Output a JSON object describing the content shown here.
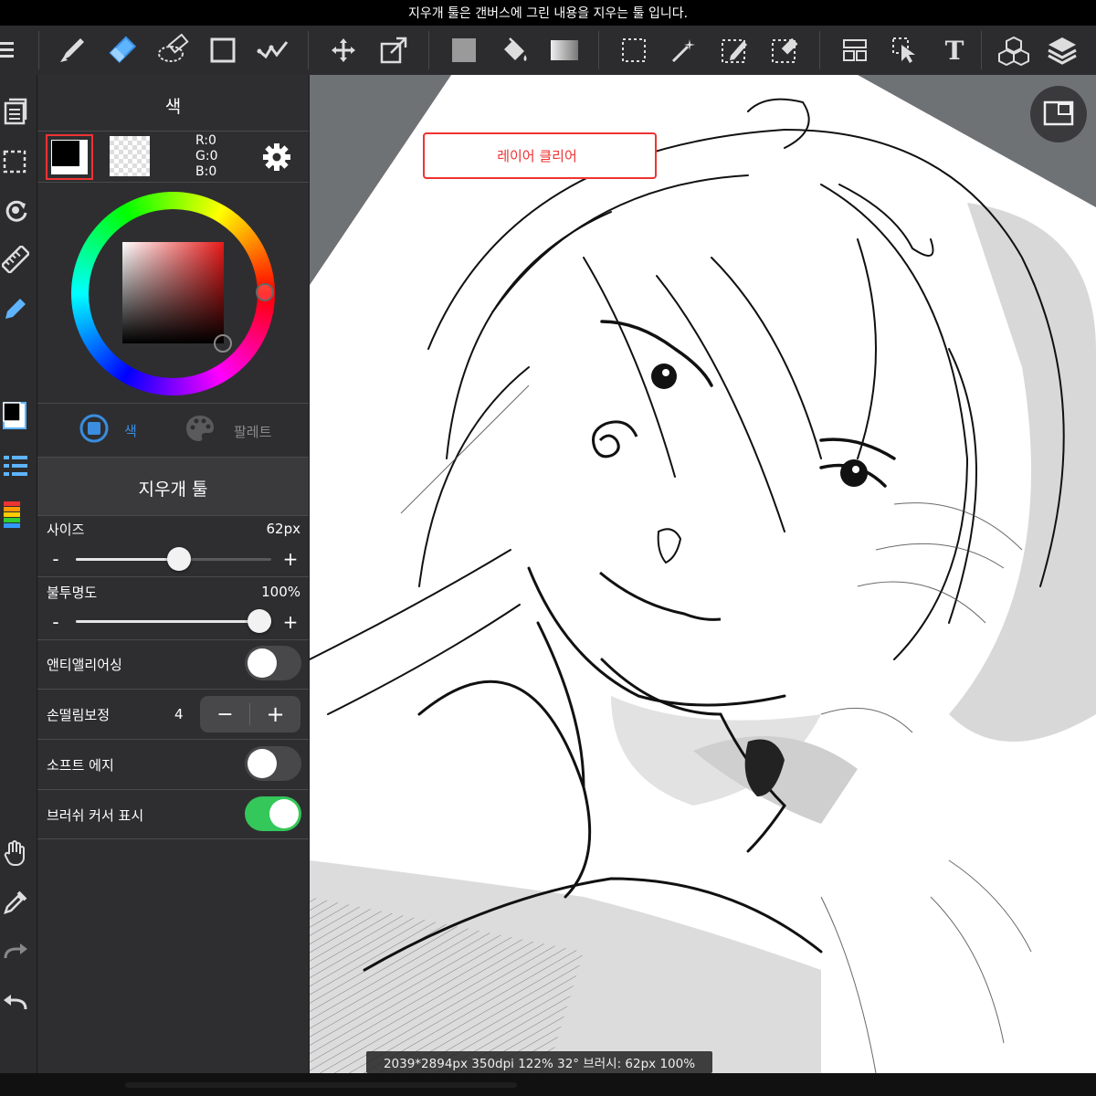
{
  "hint": "지우개 툴은 갠버스에 그린 내용을 지우는 툴 입니다.",
  "toolbar": {
    "tools": [
      "menu-icon",
      "brush-icon",
      "eraser-icon",
      "lasso-eraser-icon",
      "rectangle-icon",
      "check-icon",
      "move-icon",
      "transform-icon",
      "fill-color-icon",
      "bucket-icon",
      "gradient-icon",
      "select-rect-icon",
      "magic-wand-icon",
      "select-pen-icon",
      "select-eraser-icon",
      "panel-layout-icon",
      "select-move-icon",
      "text-icon",
      "3d-icon",
      "layers-icon"
    ]
  },
  "color_panel": {
    "title": "색",
    "rgb": {
      "r": "R:0",
      "g": "G:0",
      "b": "B:0"
    },
    "tab_color": "색",
    "tab_palette": "팔레트",
    "primary_color": "#000000"
  },
  "eraser_panel": {
    "title": "지우개 툴",
    "size_label": "사이즈",
    "size_value": "62px",
    "size_level": 0.53,
    "opacity_label": "불투명도",
    "opacity_value": "100%",
    "opacity_level": 1.0,
    "antialias_label": "앤티앨리어싱",
    "antialias_on": false,
    "stabilizer_label": "손떨림보정",
    "stabilizer_value": "4",
    "soft_edge_label": "소프트 에지",
    "soft_edge_on": false,
    "brush_cursor_label": "브러쉬 커서 표시",
    "brush_cursor_on": true,
    "minus": "-",
    "plus": "+",
    "stepper_minus": "−",
    "stepper_plus": "+"
  },
  "toast": "레이어 클리어",
  "status": "2039*2894px 350dpi 122% 32° 브러시: 62px 100%",
  "colors": {
    "accent": "#3a8de0",
    "toggle_on": "#34c759",
    "toast_red": "#e33333"
  }
}
